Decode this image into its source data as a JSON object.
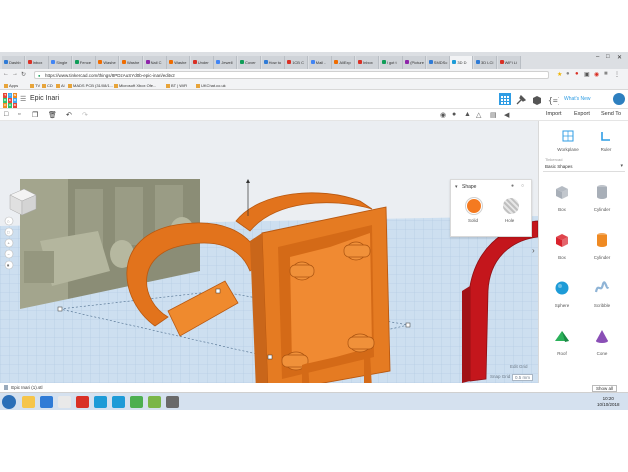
{
  "browser": {
    "tabs": [
      {
        "label": "Dashb",
        "color": "#2f7bd6"
      },
      {
        "label": "Inbox",
        "color": "#d93025"
      },
      {
        "label": "Single",
        "color": "#4285f4"
      },
      {
        "label": "Fence",
        "color": "#0f9d58"
      },
      {
        "label": "Washe",
        "color": "#ef6c00"
      },
      {
        "label": "Washe",
        "color": "#ef6c00"
      },
      {
        "label": "Nail C",
        "color": "#8e24aa"
      },
      {
        "label": "Washe",
        "color": "#ef6c00"
      },
      {
        "label": "Under",
        "color": "#d93025"
      },
      {
        "label": "Jewell",
        "color": "#4285f4"
      },
      {
        "label": "Cover",
        "color": "#0f9d58"
      },
      {
        "label": "How to",
        "color": "#2f7bd6"
      },
      {
        "label": "1CB C",
        "color": "#d93025"
      },
      {
        "label": "Mail -",
        "color": "#4285f4"
      },
      {
        "label": "AliExp",
        "color": "#ef6c00"
      },
      {
        "label": "Inbox",
        "color": "#d93025"
      },
      {
        "label": "I got t",
        "color": "#0f9d58"
      },
      {
        "label": "(Picture",
        "color": "#8e24aa"
      },
      {
        "label": "SMDSc",
        "color": "#2f7bd6"
      },
      {
        "label": "3D D",
        "color": "#1b9bd7"
      },
      {
        "label": "3D LCI",
        "color": "#2f7bd6"
      },
      {
        "label": "WiFi Li",
        "color": "#d93025"
      }
    ],
    "url": "https://www.tinkercad.com/things/8PDzAuSYd0b-epic-inari/editv2",
    "bookmarks": [
      {
        "label": "Apps"
      },
      {
        "label": "TV"
      },
      {
        "label": "CD"
      },
      {
        "label": "Al"
      },
      {
        "label": "MADS PCB (31/08/1..."
      },
      {
        "label": "Microsoft Xbox Ofe..."
      },
      {
        "label": "BT | WiFi"
      },
      {
        "label": "UKChat.co.uk"
      }
    ]
  },
  "tinkercad": {
    "logo_letters": [
      "T",
      "I",
      "N",
      "K",
      "E",
      "R",
      "C",
      "A",
      "D"
    ],
    "logo_colors": [
      "#e54637",
      "#3fa9f5",
      "#ef8a23",
      "#2ec26e",
      "#e54637",
      "#3fa9f5",
      "#ef8a23",
      "#2ec26e",
      "#e54637"
    ],
    "design_name": "Epic Inari",
    "whats_new": "What's New",
    "right_tabs": {
      "import": "Import",
      "export": "Export",
      "send_to": "Send To"
    }
  },
  "inspector": {
    "title": "Shape",
    "solid_label": "Solid",
    "hole_label": "Hole",
    "solid_color": "#f47a20"
  },
  "shapes_panel": {
    "workplane_label": "Workplane",
    "ruler_label": "Ruler",
    "category_small": "Tinkercad",
    "category": "Basic Shapes",
    "shapes": [
      {
        "label": "Box",
        "color": "#a8afb8",
        "kind": "box"
      },
      {
        "label": "Cylinder",
        "color": "#a8afb8",
        "kind": "cyl"
      },
      {
        "label": "Box",
        "color": "#d9232d",
        "kind": "box"
      },
      {
        "label": "Cylinder",
        "color": "#ef8a23",
        "kind": "cyl"
      },
      {
        "label": "Sphere",
        "color": "#1d9bd7",
        "kind": "sphere"
      },
      {
        "label": "Scribble",
        "color": "#8fb4d6",
        "kind": "scribble"
      },
      {
        "label": "Roof",
        "color": "#2bb15a",
        "kind": "roof"
      },
      {
        "label": "Cone",
        "color": "#8a4fb6",
        "kind": "cone"
      }
    ]
  },
  "grid": {
    "edit_grid": "Edit Grid",
    "snap_grid_label": "Snap Grid",
    "snap_grid_value": "0.5 mm"
  },
  "download": {
    "file": "Epic Inari (1).stl",
    "show_all": "Show all"
  },
  "taskbar": {
    "time": "10:20",
    "date": "10/10/2018"
  },
  "colors": {
    "part_orange": "#e97a1f",
    "part_red": "#c4161c",
    "part_olive": "#8d8f79",
    "workplane": "#cfe0f0"
  }
}
